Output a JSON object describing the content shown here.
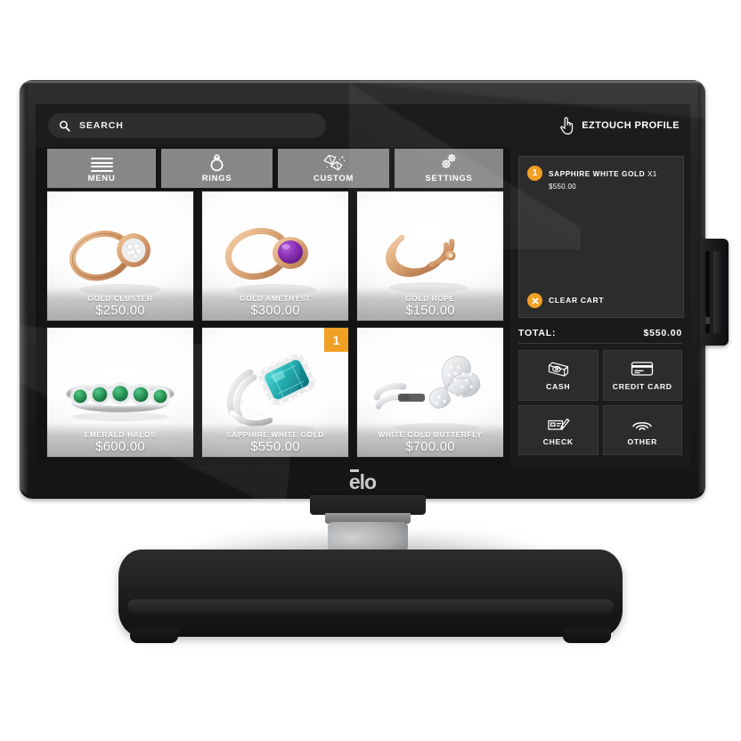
{
  "device": {
    "brand_logo": "elo",
    "side_module_name": "card-reader-module"
  },
  "topbar": {
    "search_placeholder": "SEARCH",
    "search_value": "",
    "search_icon": "search-icon",
    "profile_icon": "touch-hand-icon",
    "profile_label_bold": "EZ",
    "profile_label_rest": "TOUCH PROFILE"
  },
  "nav": {
    "tabs": [
      {
        "label": "MENU",
        "icon": "hamburger-menu-icon"
      },
      {
        "label": "RINGS",
        "icon": "ring-icon"
      },
      {
        "label": "CUSTOM",
        "icon": "gems-icon"
      },
      {
        "label": "SETTINGS",
        "icon": "gears-icon"
      }
    ]
  },
  "products": [
    {
      "name": "GOLD CLUSTER",
      "price": "$250.00",
      "badge": ""
    },
    {
      "name": "GOLD AMETHYST",
      "price": "$300.00",
      "badge": ""
    },
    {
      "name": "GOLD ROPE",
      "price": "$150.00",
      "badge": ""
    },
    {
      "name": "EMERALD HALOS",
      "price": "$600.00",
      "badge": ""
    },
    {
      "name": "SAPPHIRE WHITE GOLD",
      "price": "$550.00",
      "badge": "1"
    },
    {
      "name": "WHITE GOLD BUTTERFLY",
      "price": "$700.00",
      "badge": ""
    }
  ],
  "cart": {
    "items": [
      {
        "qty_badge": "1",
        "name": "SAPPHIRE WHITE GOLD",
        "qty_label": "X1",
        "price": "$550.00"
      }
    ],
    "clear_label": "CLEAR CART",
    "clear_icon": "x-circle-icon",
    "total_label": "TOTAL:",
    "total_value": "$550.00"
  },
  "payment": {
    "buttons": [
      {
        "label": "CASH",
        "icon": "cash-icon"
      },
      {
        "label": "CREDIT CARD",
        "icon": "credit-card-icon"
      },
      {
        "label": "CHECK",
        "icon": "check-pen-icon"
      },
      {
        "label": "OTHER",
        "icon": "contactless-wifi-icon"
      }
    ]
  },
  "colors": {
    "accent_orange": "#f0a024",
    "nav_tab_gray": "#878787",
    "screen_bg": "#141414",
    "panel_bg": "#1b1b1b",
    "tile_bg": "#2c2c2c"
  }
}
